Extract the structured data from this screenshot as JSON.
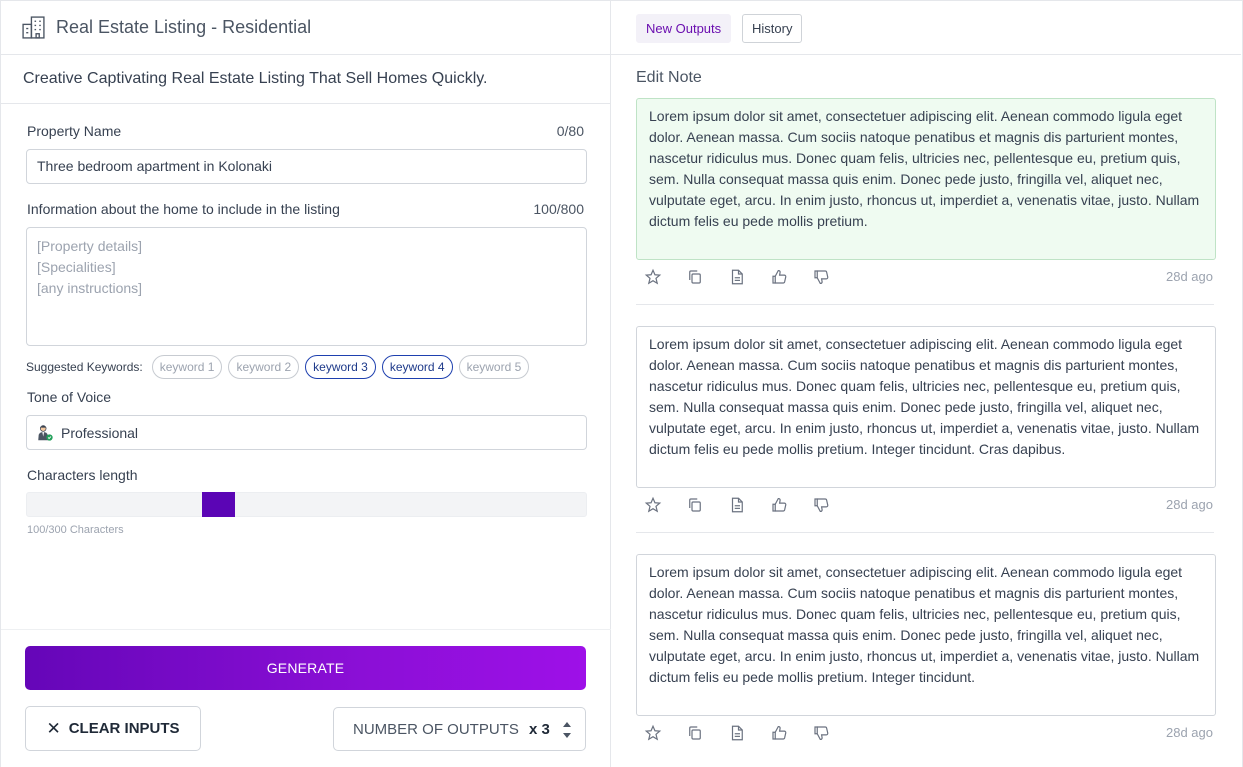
{
  "left": {
    "title": "Real Estate Listing - Residential",
    "subtitle": "Creative Captivating Real Estate Listing That Sell Homes Quickly.",
    "property_name": {
      "label": "Property Name",
      "count": "0/80",
      "value": "Three bedroom apartment in Kolonaki"
    },
    "info": {
      "label": "Information about the home to include in the listing",
      "count": "100/800",
      "placeholder": "[Property details]\n[Specialities]\n[any instructions]"
    },
    "keywords": {
      "label": "Suggested Keywords:",
      "items": [
        {
          "text": "keyword 1",
          "selected": false
        },
        {
          "text": "keyword 2",
          "selected": false
        },
        {
          "text": "keyword 3",
          "selected": true
        },
        {
          "text": "keyword 4",
          "selected": true
        },
        {
          "text": "keyword 5",
          "selected": false
        }
      ]
    },
    "tone": {
      "label": "Tone of Voice",
      "value": "Professional",
      "icon": "professional-person-icon"
    },
    "length": {
      "label": "Characters length",
      "caption": "100/300 Characters",
      "value": 100,
      "max": 300
    },
    "generate_label": "GENERATE",
    "clear_label": "CLEAR INPUTS",
    "outputs": {
      "label": "NUMBER OF OUTPUTS",
      "value": "x 3"
    },
    "colors": {
      "accent": "#5b05b5",
      "gradient_end": "#9e10e8"
    }
  },
  "right": {
    "tabs": [
      {
        "label": "New Outputs",
        "active": true
      },
      {
        "label": "History",
        "active": false
      }
    ],
    "edit_note": "Edit Note",
    "outputs": [
      {
        "text": "Lorem ipsum dolor sit amet, consectetuer adipiscing elit. Aenean commodo ligula eget dolor. Aenean massa. Cum sociis natoque penatibus et magnis dis parturient montes, nascetur ridiculus mus. Donec quam felis, ultricies nec, pellentesque eu, pretium quis, sem. Nulla consequat massa quis enim. Donec pede justo, fringilla vel, aliquet nec, vulputate eget, arcu. In enim justo, rhoncus ut, imperdiet a, venenatis vitae, justo. Nullam dictum felis eu pede mollis pretium.",
        "time": "28d ago",
        "highlighted": true
      },
      {
        "text": "Lorem ipsum dolor sit amet, consectetuer adipiscing elit. Aenean commodo ligula eget dolor. Aenean massa. Cum sociis natoque penatibus et magnis dis parturient montes, nascetur ridiculus mus. Donec quam felis, ultricies nec, pellentesque eu, pretium quis, sem. Nulla consequat massa quis enim. Donec pede justo, fringilla vel, aliquet nec, vulputate eget, arcu. In enim justo, rhoncus ut, imperdiet a, venenatis vitae, justo. Nullam dictum felis eu pede mollis pretium. Integer tincidunt. Cras dapibus.",
        "time": "28d ago",
        "highlighted": false
      },
      {
        "text": "Lorem ipsum dolor sit amet, consectetuer adipiscing elit. Aenean commodo ligula eget dolor. Aenean massa. Cum sociis natoque penatibus et magnis dis parturient montes, nascetur ridiculus mus. Donec quam felis, ultricies nec, pellentesque eu, pretium quis, sem. Nulla consequat massa quis enim. Donec pede justo, fringilla vel, aliquet nec, vulputate eget, arcu. In enim justo, rhoncus ut, imperdiet a, venenatis vitae, justo. Nullam dictum felis eu pede mollis pretium. Integer tincidunt.",
        "time": "28d ago",
        "highlighted": false
      }
    ],
    "action_icons": [
      "star-icon",
      "copy-icon",
      "document-icon",
      "thumbs-up-icon",
      "thumbs-down-icon"
    ]
  }
}
